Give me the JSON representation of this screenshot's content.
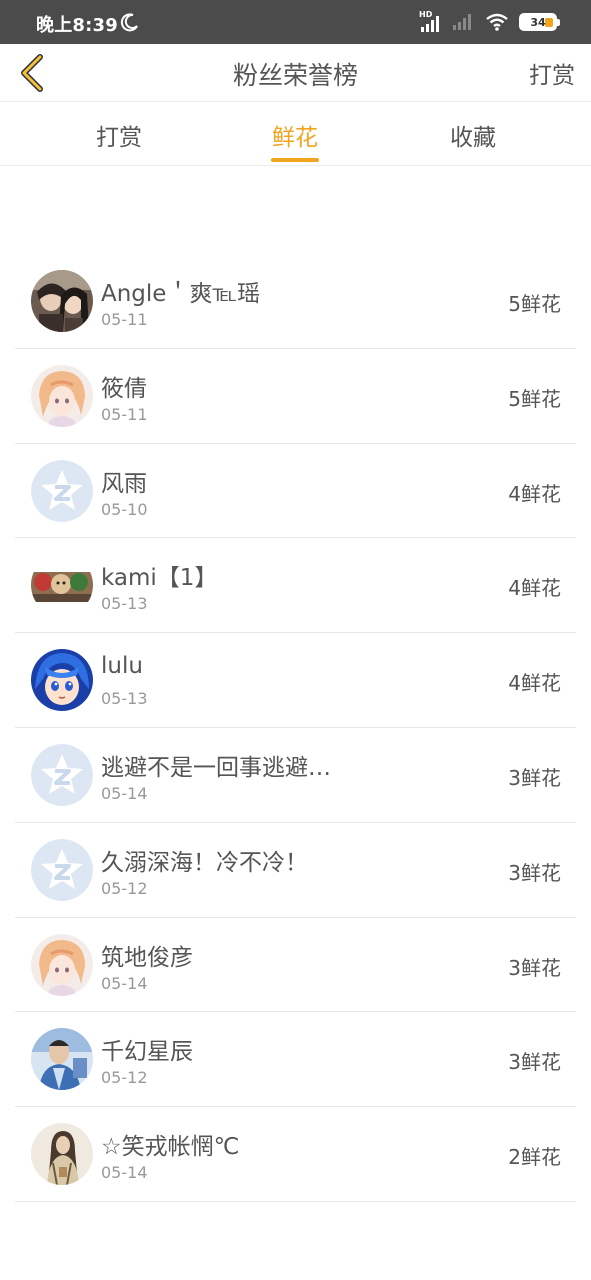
{
  "status_bar": {
    "time": "晚上8:39",
    "hd": "HD",
    "battery": "34"
  },
  "header": {
    "title": "粉丝荣誉榜",
    "action_label": "打赏"
  },
  "tabs": [
    {
      "label": "打赏",
      "active": false
    },
    {
      "label": "鲜花",
      "active": true
    },
    {
      "label": "收藏",
      "active": false
    }
  ],
  "accent_color": "#f0a41f",
  "fans": [
    {
      "name": "Angle＇爽℡瑶",
      "date": "05-11",
      "count": "5鲜花",
      "avatar": "photo-two-girls"
    },
    {
      "name": "筱倩",
      "date": "05-11",
      "count": "5鲜花",
      "avatar": "anime-blonde"
    },
    {
      "name": "风雨",
      "date": "05-10",
      "count": "4鲜花",
      "avatar": "qzone-default"
    },
    {
      "name": "kami【1】",
      "date": "05-13",
      "count": "4鲜花",
      "avatar": "photo-plush-toys"
    },
    {
      "name": "lulu",
      "date": "05-13",
      "count": "4鲜花",
      "avatar": "anime-blue-hair"
    },
    {
      "name": "逃避不是一回事逃避…",
      "date": "05-14",
      "count": "3鲜花",
      "avatar": "qzone-default"
    },
    {
      "name": "久溺深海！冷不冷！",
      "date": "05-12",
      "count": "3鲜花",
      "avatar": "qzone-default"
    },
    {
      "name": "筑地俊彦",
      "date": "05-14",
      "count": "3鲜花",
      "avatar": "anime-blonde"
    },
    {
      "name": "千幻星辰",
      "date": "05-12",
      "count": "3鲜花",
      "avatar": "photo-man-blue"
    },
    {
      "name": "☆笑戎帐惘℃",
      "date": "05-14",
      "count": "2鲜花",
      "avatar": "photo-woman"
    }
  ]
}
